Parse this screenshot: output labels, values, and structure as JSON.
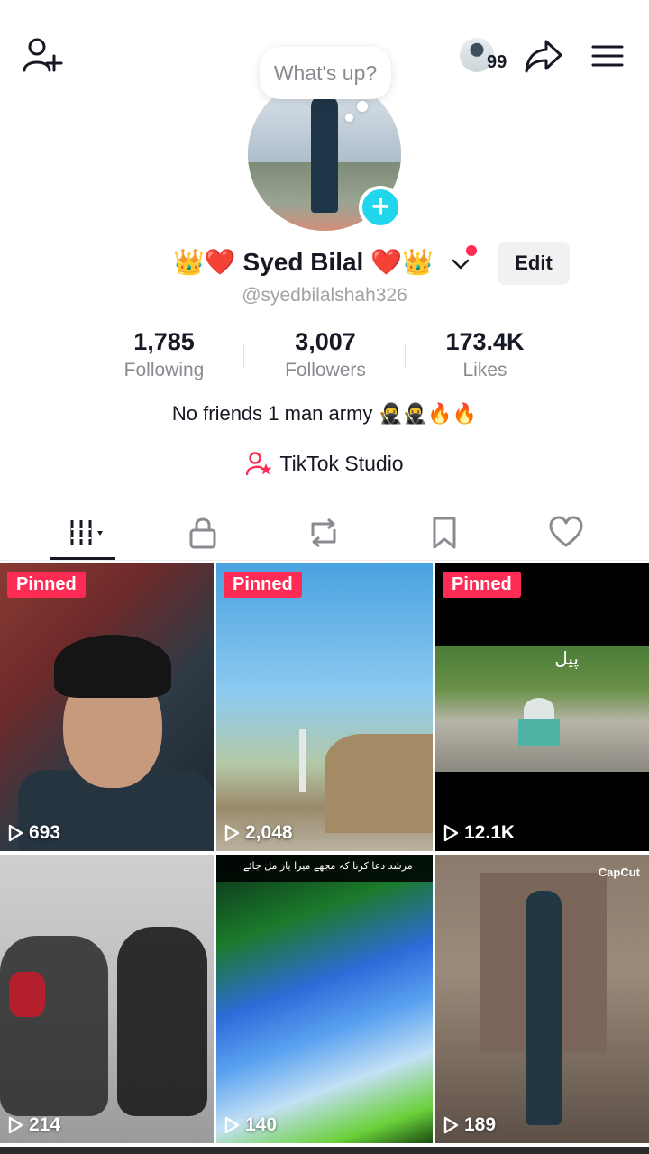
{
  "header": {
    "friends_count": "99",
    "bubble_text": "What's up?"
  },
  "profile": {
    "display_name": "👑❤️ Syed Bilal ❤️👑",
    "username": "@syedbilalshah326",
    "edit_label": "Edit",
    "bio": "No friends 1 man army 🥷🥷🔥🔥",
    "studio_label": "TikTok Studio"
  },
  "stats": [
    {
      "value": "1,785",
      "label": "Following"
    },
    {
      "value": "3,007",
      "label": "Followers"
    },
    {
      "value": "173.4K",
      "label": "Likes"
    }
  ],
  "tabs": [
    "videos",
    "private",
    "reposts",
    "favorites",
    "liked"
  ],
  "videos": [
    {
      "pinned": "Pinned",
      "views": "693"
    },
    {
      "pinned": "Pinned",
      "views": "2,048"
    },
    {
      "pinned": "Pinned",
      "views": "12.1K"
    },
    {
      "pinned": "",
      "views": "214"
    },
    {
      "pinned": "",
      "views": "140"
    },
    {
      "pinned": "",
      "views": "189"
    }
  ],
  "overlay_text": {
    "tile3_caption": "پیل",
    "tile5_caption": "مرشد دعا کرنا کہ مجھے میرا یار مل جائے",
    "tile6_watermark": "CapCut"
  },
  "colors": {
    "accent_pink": "#fe2c55",
    "accent_cyan": "#20d5ec",
    "text_primary": "#161823",
    "text_secondary": "#8a8b91"
  },
  "icons": {
    "add_friend": "person-plus-icon",
    "share": "share-arrow-icon",
    "menu": "hamburger-menu-icon",
    "studio": "studio-person-star-icon"
  }
}
